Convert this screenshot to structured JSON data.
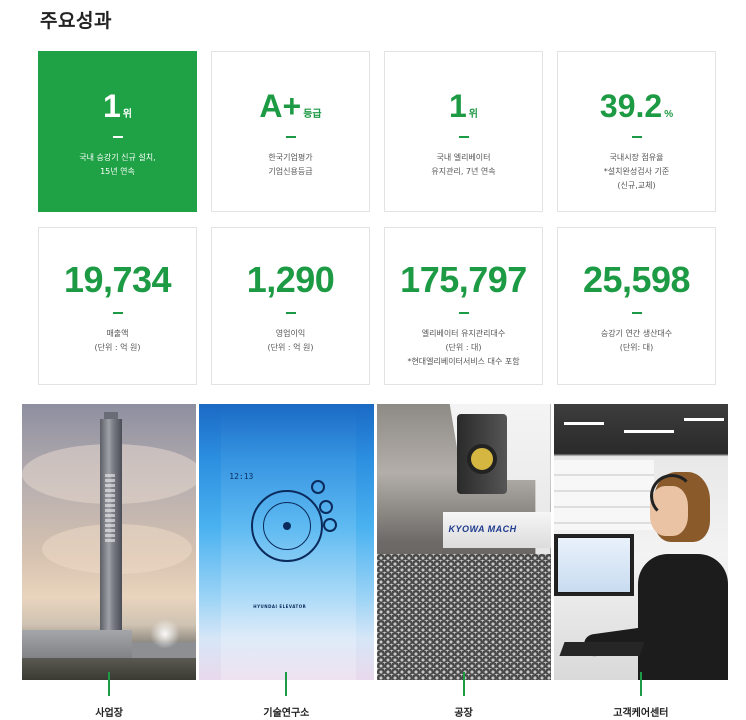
{
  "section": {
    "title": "주요성과"
  },
  "stats": {
    "row1": [
      {
        "value": "1",
        "unit": "위",
        "desc": "국내 승강기 신규 설치,\n15년 연속",
        "highlight": true
      },
      {
        "value": "A+",
        "unit": "등급",
        "desc": "한국기업평가\n기업신용등급",
        "highlight": false
      },
      {
        "value": "1",
        "unit": "위",
        "desc": "국내 엘리베이터\n유지관리, 7년 연속",
        "highlight": false
      },
      {
        "value": "39.2",
        "unit": "%",
        "desc": "국내시장 점유율\n*설치완성검사 기준\n(신규,교체)",
        "highlight": false
      }
    ],
    "row2": [
      {
        "value": "19,734",
        "unit": "",
        "desc": "매출액\n(단위 : 억 원)"
      },
      {
        "value": "1,290",
        "unit": "",
        "desc": "영업이익\n(단위 : 억 원)"
      },
      {
        "value": "175,797",
        "unit": "",
        "desc": "엘리베이터 유지관리대수\n(단위 : 대)\n*현대엘리베이터서비스 대수 포함"
      },
      {
        "value": "25,598",
        "unit": "",
        "desc": "승강기 연간 생산대수\n(단위: 대)"
      }
    ]
  },
  "photos": [
    {
      "label": "사업장",
      "icon": "building-photo"
    },
    {
      "label": "기술연구소",
      "icon": "research-photo"
    },
    {
      "label": "공장",
      "icon": "factory-photo"
    },
    {
      "label": "고객케어센터",
      "icon": "callcenter-photo"
    }
  ],
  "photo_text": {
    "clock": "12:13",
    "brand": "HYUNDAI ELEVATOR",
    "machine": "KYOWA MACH"
  },
  "colors": {
    "accent": "#1d9a44",
    "highlight_bg": "#1ea245"
  }
}
